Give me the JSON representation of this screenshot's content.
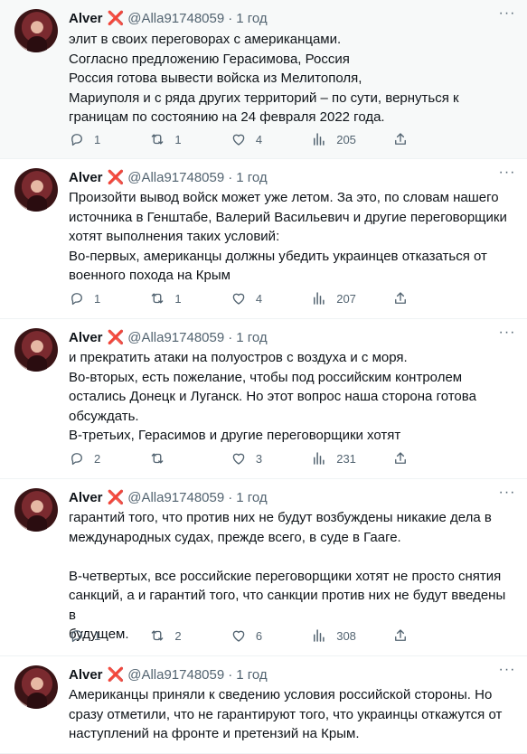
{
  "tweets": [
    {
      "name": "Alver",
      "badge": "❌",
      "handle": "@Alla91748059",
      "dot": "·",
      "time": "1 год",
      "text": "элит в своих переговорах с американцами.\nСогласно предложению Герасимова, Россия\nРоссия готова вывести войска из Мелитополя,\n Мариуполя и с ряда других территорий – по сути, вернуться к\nграницам по состоянию на 24 февраля 2022 года.",
      "replies": "1",
      "retweets": "1",
      "likes": "4",
      "views": "205"
    },
    {
      "name": "Alver",
      "badge": "❌",
      "handle": "@Alla91748059",
      "dot": "·",
      "time": "1 год",
      "text": "Произойти вывод войск может уже летом. За это, по словам нашего\nисточника в Генштабе, Валерий Васильевич и другие переговорщики\nхотят выполнения таких условий:\nВо-первых, американцы должны убедить украинцев отказаться от\nвоенного похода на Крым",
      "replies": "1",
      "retweets": "1",
      "likes": "4",
      "views": "207"
    },
    {
      "name": "Alver",
      "badge": "❌",
      "handle": "@Alla91748059",
      "dot": "·",
      "time": "1 год",
      "text": "и прекратить атаки на полуостров с воздуха и с моря.\nВо-вторых, есть пожелание, чтобы под российским контролем\nостались Донецк и Луганск. Но этот вопрос наша сторона готова\nобсуждать.\nВ-третьих, Герасимов и другие переговорщики хотят",
      "replies": "2",
      "retweets": "",
      "likes": "3",
      "views": "231"
    },
    {
      "name": "Alver",
      "badge": "❌",
      "handle": "@Alla91748059",
      "dot": "·",
      "time": "1 год",
      "text": "гарантий того, что против них не будут возбуждены никакие дела в\nмеждународных судах, прежде всего, в суде в Гааге.\n\nВ-четвертых, все российские переговорщики хотят не просто снятия\nсанкций, а и гарантий того, что санкции против них не будут введены в\nбудущем.",
      "replies": "1",
      "retweets": "2",
      "likes": "6",
      "views": "308"
    },
    {
      "name": "Alver",
      "badge": "❌",
      "handle": "@Alla91748059",
      "dot": "·",
      "time": "1 год",
      "text": "Американцы приняли к сведению условия российской стороны. Но\nсразу отметили, что не гарантируют того, что украинцы откажутся от\nнаступлений на фронте и претензий на Крым.",
      "replies": "",
      "retweets": "",
      "likes": "",
      "views": ""
    }
  ],
  "icons": {
    "more": "more-icon",
    "reply": "reply-icon",
    "retweet": "retweet-icon",
    "like": "like-icon",
    "views": "views-icon",
    "share": "share-icon"
  },
  "colors": {
    "text": "#0f1419",
    "muted": "#536471",
    "badge": "#d8242b",
    "highlight_bg": "#f7f9f9"
  }
}
